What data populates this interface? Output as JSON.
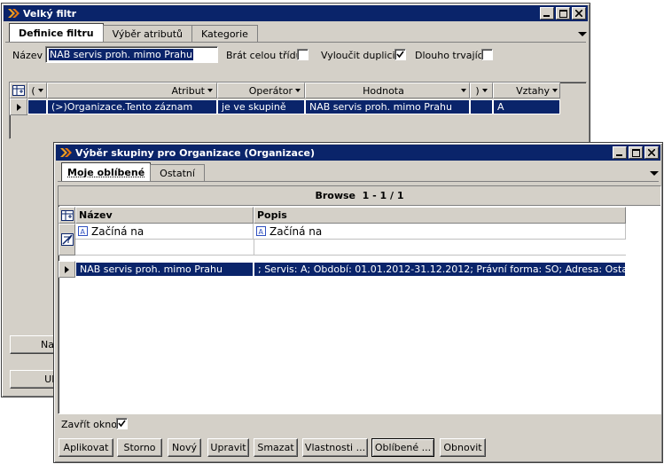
{
  "main_window": {
    "title": "Velký filtr",
    "tabs": [
      "Definice filtru",
      "Výběr atributů",
      "Kategorie"
    ],
    "name_label": "Název",
    "name_value": "NAB servis proh. mimo Prahu",
    "chk_class_label": "Brát celou třídu",
    "chk_class_checked": false,
    "chk_dup_label": "Vyloučit duplicity",
    "chk_dup_checked": true,
    "chk_long_label": "Dlouho trvající",
    "chk_long_checked": false,
    "grid": {
      "columns": [
        "(",
        "Atribut",
        "Operátor",
        "Hodnota",
        ")",
        "Vztahy"
      ],
      "row": [
        "",
        "(>)Organizace.Tento záznam",
        "je ve skupině",
        "NAB servis proh. mimo Prahu",
        "",
        "A"
      ]
    },
    "btn_partial_1": "Nah",
    "btn_partial_2": "Ulo"
  },
  "dialog": {
    "title": "Výběr skupiny pro Organizace (Organizace)",
    "tabs": [
      "Moje oblíbené",
      "Ostatní"
    ],
    "browse_label": "Browse  1 - 1 / 1",
    "columns": [
      "Název",
      "Popis"
    ],
    "filter_row": [
      "Začíná na",
      "Začíná na"
    ],
    "rows": [
      [
        "NAB servis proh. mimo Prahu",
        "; Servis: A; Období: 01.01.2012-31.12.2012; Právní forma: SO; Adresa: Ostatní"
      ]
    ],
    "close_label": "Zavřít okno",
    "close_checked": true,
    "buttons": [
      "Aplikovat",
      "Storno",
      "Nový",
      "Upravit",
      "Smazat",
      "Vlastnosti ...",
      "Oblíbené ...",
      "Obnovit"
    ]
  },
  "icons": {
    "app": "filter-app-icon",
    "minimize": "minimize-icon",
    "maximize": "maximize-icon",
    "close": "close-icon",
    "grid_config": "grid-config-icon",
    "filter_clear": "filter-clear-icon",
    "text_filter": "text-filter-icon",
    "row_pointer": "row-pointer-icon"
  },
  "colors": {
    "titlebar": "#0a246a",
    "selection": "#0a246a",
    "face": "#d4d0c8"
  }
}
